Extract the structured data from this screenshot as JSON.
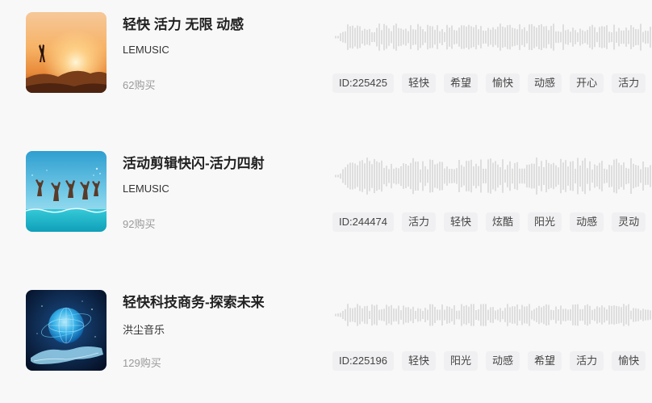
{
  "tracks": [
    {
      "title": "轻快 活力 无限 动感",
      "artist": "LEMUSIC",
      "purchases": "62购买",
      "cover_icon": "sunset-silhouette-thumbnail",
      "tags": [
        "ID:225425",
        "轻快",
        "希望",
        "愉快",
        "动感",
        "开心",
        "活力"
      ]
    },
    {
      "title": "活动剪辑快闪-活力四射",
      "artist": "LEMUSIC",
      "purchases": "92购买",
      "cover_icon": "pool-jump-thumbnail",
      "tags": [
        "ID:244474",
        "活力",
        "轻快",
        "炫酷",
        "阳光",
        "动感",
        "灵动"
      ]
    },
    {
      "title": "轻快科技商务-探索未来",
      "artist": "洪尘音乐",
      "purchases": "129购买",
      "cover_icon": "globe-in-hand-thumbnail",
      "tags": [
        "ID:225196",
        "轻快",
        "阳光",
        "动感",
        "希望",
        "活力",
        "愉快"
      ]
    }
  ],
  "colors": {
    "background": "#f8f8f9",
    "waveform": "#c4c4c4",
    "tag_background": "#f0f0f2"
  }
}
